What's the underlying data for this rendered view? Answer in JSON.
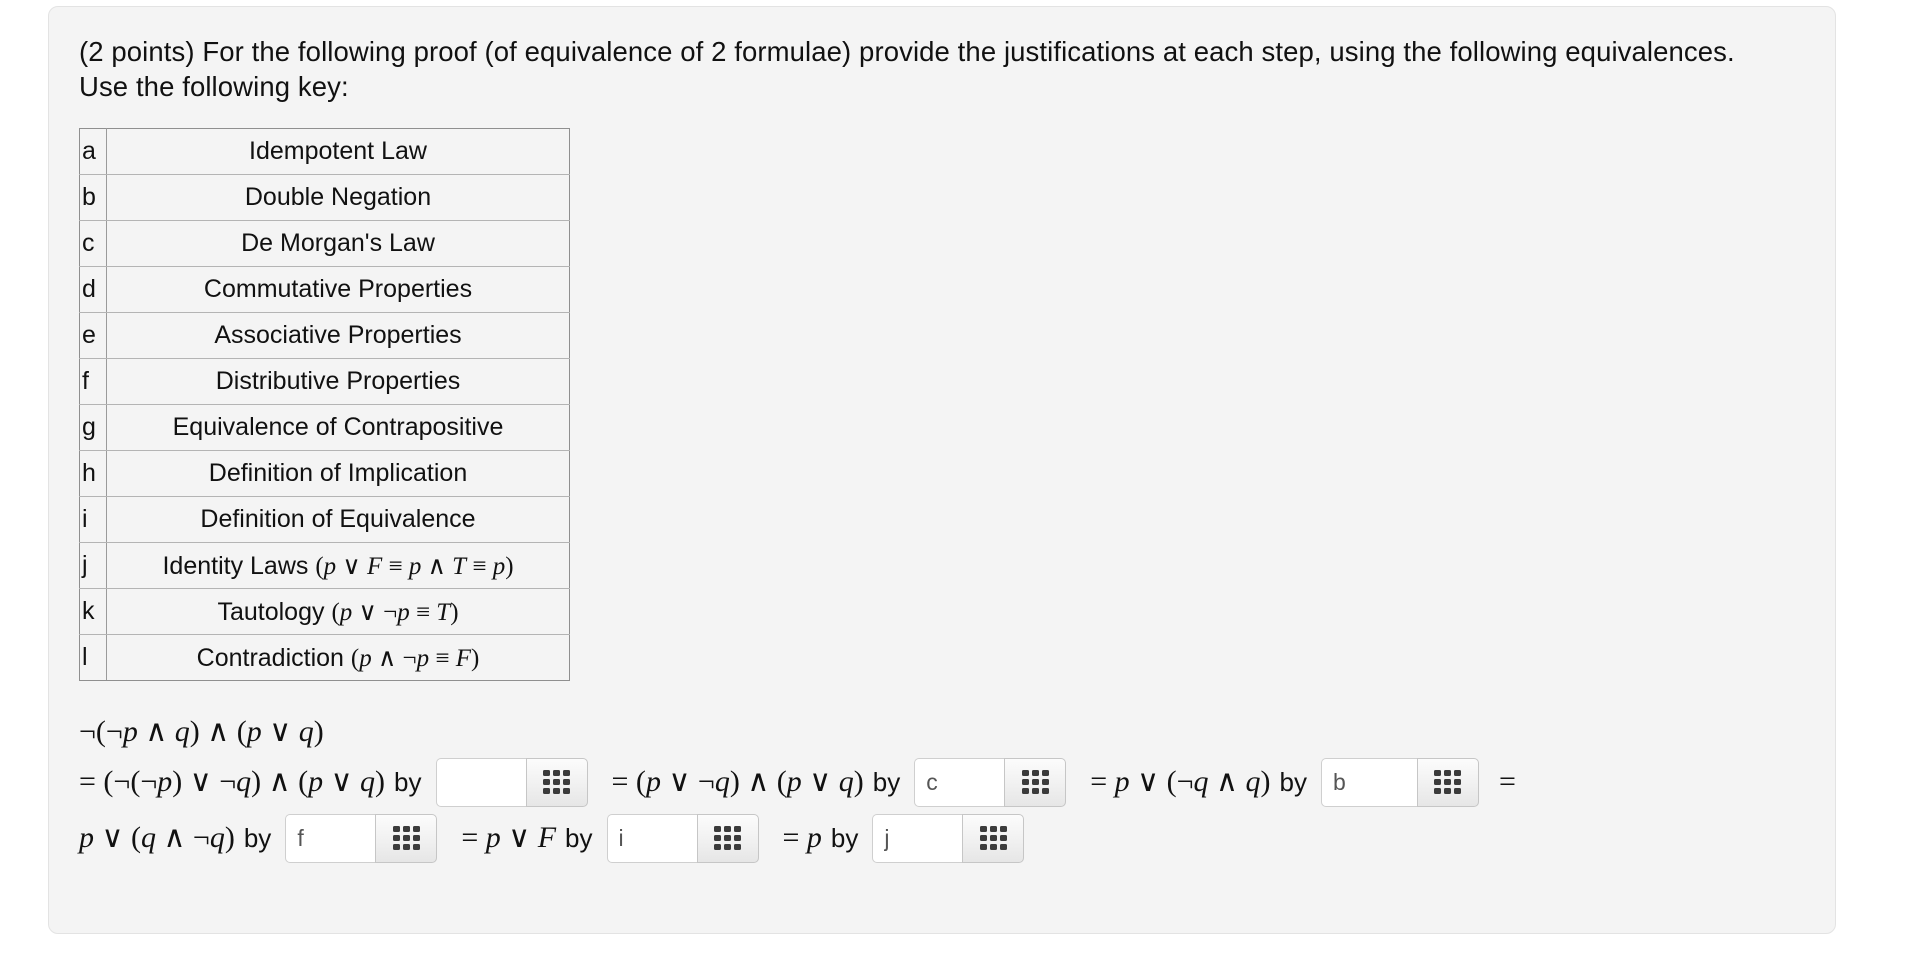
{
  "question": {
    "points_label": "(2 points)",
    "line1": "(2 points) For the following proof (of equivalence of 2 formulae) provide the justifications at each step, using the following equivalences.",
    "line2": "Use the following key:"
  },
  "key_table": {
    "rows": [
      {
        "letter": "a",
        "law": "Idempotent Law"
      },
      {
        "letter": "b",
        "law": "Double Negation"
      },
      {
        "letter": "c",
        "law": "De Morgan's Law"
      },
      {
        "letter": "d",
        "law": "Commutative Properties"
      },
      {
        "letter": "e",
        "law": "Associative Properties"
      },
      {
        "letter": "f",
        "law": "Distributive Properties"
      },
      {
        "letter": "g",
        "law": "Equivalence of Contrapositive"
      },
      {
        "letter": "h",
        "law": "Definition of Implication"
      },
      {
        "letter": "i",
        "law": "Definition of Equivalence"
      },
      {
        "letter": "j",
        "law": "Identity Laws (p ∨ F ≡ p ∧ T ≡ p)"
      },
      {
        "letter": "k",
        "law": "Tautology (p ∨ ¬p ≡ T)"
      },
      {
        "letter": "l",
        "law": "Contradiction (p ∧ ¬p ≡ F)"
      }
    ]
  },
  "proof": {
    "start_formula": "¬(¬p ∧ q) ∧ (p ∨ q)",
    "by_label": "by",
    "equals_sign": "=",
    "steps": [
      {
        "lead": "=",
        "formula": "(¬(¬p) ∨ ¬q) ∧ (p ∨ q)",
        "by": "by",
        "answer": "",
        "placeholder": ""
      },
      {
        "lead": "=",
        "formula": "(p ∨ ¬q) ∧ (p ∨ q)",
        "by": "by",
        "answer": "c",
        "placeholder": ""
      },
      {
        "lead": "=",
        "formula": "p ∨ (¬q ∧ q)",
        "by": "by",
        "answer": "b",
        "placeholder": ""
      },
      {
        "lead": "",
        "formula": "p ∨ (q ∧ ¬q)",
        "by": "by",
        "answer": "f",
        "placeholder": ""
      },
      {
        "lead": "=",
        "formula": "p ∨ F",
        "by": "by",
        "answer": "i",
        "placeholder": ""
      },
      {
        "lead": "=",
        "formula": "p",
        "by": "by",
        "answer": "j",
        "placeholder": ""
      }
    ],
    "trailing_equals": "="
  },
  "icons": {
    "keypad": "keypad-grid-icon"
  },
  "colors": {
    "panel_background": "#f4f4f4",
    "page_background": "#ffffff",
    "text": "#111111",
    "table_border": "#8f8f8f",
    "input_border": "#cfcfcf",
    "keypad_dot": "#3b3b3b"
  }
}
